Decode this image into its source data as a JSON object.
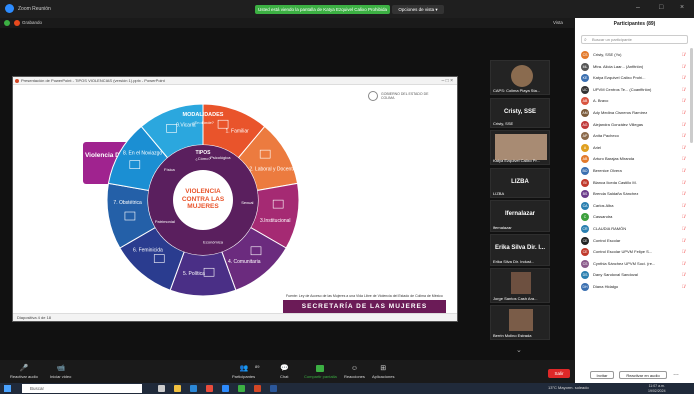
{
  "titlebar": {
    "title": "Zoom Reunión",
    "share_banner": "Usted está viendo la pantalla de Katya Ezquivel Calixo Prohibida",
    "options": "Opciones de vista"
  },
  "statusbar": {
    "rec": "Grabando",
    "view": "Vista"
  },
  "ppt": {
    "title": "Presentación de PowerPoint - TIPOS VIOLENCIAS (versión 1).pptx - PowerPoint",
    "footer": "Diapositiva 4 de 18"
  },
  "slide": {
    "box_label": "Violencia Digital",
    "center_title": "VIOLENCIA CONTRA LAS MUJERES",
    "modalidades": "MODALIDADES",
    "donde": "¿En dónde?",
    "tipos": "TIPOS",
    "como": "¿Cómo?",
    "ring": [
      {
        "label": "1. Familiar",
        "color": "#e9542b"
      },
      {
        "label": "2. Laboral y Docente",
        "color": "#ec7b3f"
      },
      {
        "label": "3.Institucional",
        "color": "#a52a73"
      },
      {
        "label": "4. Comunitaria",
        "color": "#6b2b7e"
      },
      {
        "label": "5. Política",
        "color": "#4a2f86"
      },
      {
        "label": "6. Feminicida",
        "color": "#2a3c8f"
      },
      {
        "label": "7. Obstétrica",
        "color": "#2460a8"
      },
      {
        "label": "8. En el Noviazgo",
        "color": "#1b8fd3"
      },
      {
        "label": "9.Vicaria",
        "color": "#2ba7de"
      }
    ],
    "inner": [
      "Psicológica",
      "Sexual",
      "Económica",
      "Patrimonial",
      "Física"
    ],
    "footnote": "Fuente: Ley de Acceso de las Mujeres a una Vida Libre de Violencia del Estado de Colima de México",
    "secretaria": "SECRETARÍA DE LAS MUJERES",
    "gov_logo": "GOBIERNO DEL ESTADO DE COLIMA"
  },
  "video_tiles": [
    {
      "name": "CAPS: Colima Playa Sta...",
      "photo": true
    },
    {
      "name": "Cristy, SSE",
      "big": "Cristy, SSE",
      "photo": false
    },
    {
      "name": "Katya Ezquivel Calixo Pr...",
      "photo": true
    },
    {
      "name": "LIZBA",
      "big": "LIZBA",
      "photo": false
    },
    {
      "name": "lfernalazar",
      "big": "lfernalazar",
      "photo": false
    },
    {
      "name": "Erika Silva Dir. Indust...",
      "big": "Erika Silva Dir. I...",
      "photo": false
    },
    {
      "name": "Jorge Santos Cash Ara...",
      "photo": true
    },
    {
      "name": "Berrin Molino Estrada",
      "photo": true
    }
  ],
  "toolbar": {
    "audio": "Reactivar audio",
    "video": "Iniciar video",
    "participants": "Participantes",
    "participants_count": "89",
    "chat": "Chat",
    "share": "Compartir pantalla",
    "reactions": "Reacciones",
    "apps": "Aplicaciones",
    "end": "Salir"
  },
  "panel": {
    "title": "Participantes (89)",
    "search_placeholder": "Buscar un participante",
    "participants": [
      {
        "name": "Cristy, SSE (Yo)",
        "initials": "CS",
        "color": "#e37a2b"
      },
      {
        "name": "Mtra. Alicia Laar... (Anfitrión)",
        "initials": "ML",
        "color": "#555"
      },
      {
        "name": "Katya Ezquivel Calixo Prohi...",
        "initials": "KE",
        "color": "#3a6fb0"
      },
      {
        "name": "UPVM Centros Te... (Coanfitrión)",
        "initials": "UC",
        "color": "#333"
      },
      {
        "name": "A. Bravo",
        "initials": "AB",
        "color": "#d9543f"
      },
      {
        "name": "Ady Medina Cisneros Ramírez",
        "initials": "AM",
        "color": "#7a5a3a"
      },
      {
        "name": "Alejandra González Villegas",
        "initials": "AG",
        "color": "#c03a3a"
      },
      {
        "name": "Anita Pacheco",
        "initials": "AP",
        "color": "#8b6a4b"
      },
      {
        "name": "Ariel",
        "initials": "A",
        "color": "#e0a020"
      },
      {
        "name": "Arturo Barajas Miranda",
        "initials": "AB",
        "color": "#e37a2b"
      },
      {
        "name": "Berenice Olvera",
        "initials": "BO",
        "color": "#3a6fb0"
      },
      {
        "name": "Blanca Ilceda Castillo M.",
        "initials": "BI",
        "color": "#c0392b"
      },
      {
        "name": "Brenda Saldaña Sánchez",
        "initials": "BS",
        "color": "#6a3a8a"
      },
      {
        "name": "Carlos Alba",
        "initials": "CA",
        "color": "#2a7fb0"
      },
      {
        "name": "Cassandra",
        "initials": "C",
        "color": "#3ca03c"
      },
      {
        "name": "CLAUDIA RAMÓN",
        "initials": "CR",
        "color": "#2a7fb0"
      },
      {
        "name": "Control Escolar",
        "initials": "CE",
        "color": "#222"
      },
      {
        "name": "Control Escolar UPVM Felipe S...",
        "initials": "CE",
        "color": "#c0392b"
      },
      {
        "name": "Cynthia Sánchez UPVM Soci. (re...",
        "initials": "CS",
        "color": "#8a5a8a"
      },
      {
        "name": "Dany Sandoval Sandoval",
        "initials": "DS",
        "color": "#2a7fb0"
      },
      {
        "name": "Diana Hidalgo",
        "initials": "DH",
        "color": "#3a6fb0"
      }
    ],
    "invite": "Invitar",
    "mute_all": "Reactivar en audio"
  },
  "taskbar": {
    "search": "Buscar",
    "tray": "13°C Mayorm. soleado",
    "time": "11:07 a.m.",
    "date": "19/02/2024"
  }
}
